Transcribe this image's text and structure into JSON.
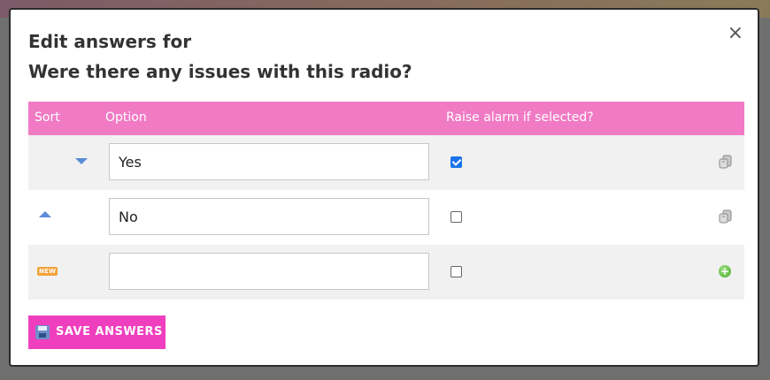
{
  "modal": {
    "title_line1": "Edit answers for",
    "title_line2": "Were there any issues with this radio?",
    "close_symbol": "×"
  },
  "table": {
    "headers": {
      "sort": "Sort",
      "option": "Option",
      "alarm": "Raise alarm if selected?"
    },
    "rows": [
      {
        "sort_icon": "move-down-icon",
        "option": "Yes",
        "raise_alarm": true,
        "action_icon": "delete-icon"
      },
      {
        "sort_icon": "move-up-icon",
        "option": "No",
        "raise_alarm": false,
        "action_icon": "delete-icon"
      },
      {
        "sort_icon": "new-badge-icon",
        "sort_badge": "NEW",
        "option": "",
        "raise_alarm": false,
        "action_icon": "add-icon"
      }
    ]
  },
  "save_button": {
    "label": "SAVE ANSWERS",
    "icon": "floppy-disk-icon"
  },
  "colors": {
    "header_bg": "#f07bc4",
    "button_bg": "#ef3fbe",
    "alt_row_bg": "#f1f1f1",
    "sort_arrow": "#5b8bd8"
  }
}
